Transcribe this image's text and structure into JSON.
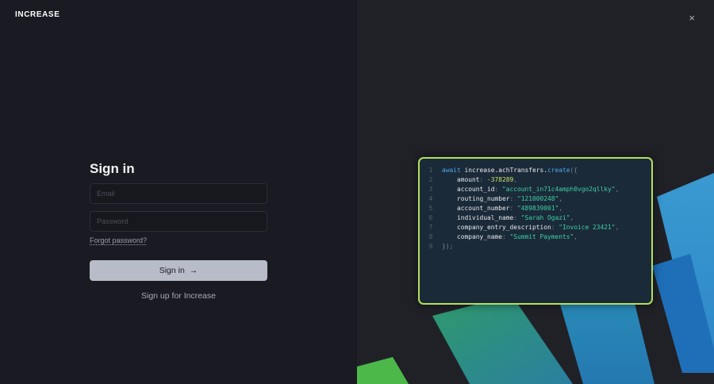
{
  "brand": "INCREASE",
  "close_icon": "×",
  "form": {
    "title": "Sign in",
    "email_placeholder": "Email",
    "password_placeholder": "Password",
    "forgot": "Forgot password?",
    "submit": "Sign in",
    "submit_arrow": "→",
    "signup": "Sign up for Increase"
  },
  "code": {
    "lines": [
      {
        "n": "1",
        "a": "await ",
        "b": "increase.achTransfers.",
        "c": "create",
        "d": "({"
      },
      {
        "n": "2",
        "key": "    amount",
        "val": "-378289",
        "type": "num"
      },
      {
        "n": "3",
        "key": "    account_id",
        "val": "\"account_in71c4amph0vgo2qllky\"",
        "type": "str"
      },
      {
        "n": "4",
        "key": "    routing_number",
        "val": "\"121000248\"",
        "type": "str"
      },
      {
        "n": "5",
        "key": "    account_number",
        "val": "\"489839001\"",
        "type": "str"
      },
      {
        "n": "6",
        "key": "    individual_name",
        "val": "\"Sarah Ogazi\"",
        "type": "str"
      },
      {
        "n": "7",
        "key": "    company_entry_description",
        "val": "\"Invoice 23421\"",
        "type": "str"
      },
      {
        "n": "8",
        "key": "    company_name",
        "val": "\"Summit Payments\"",
        "type": "str"
      },
      {
        "n": "9",
        "end": "});"
      }
    ]
  }
}
